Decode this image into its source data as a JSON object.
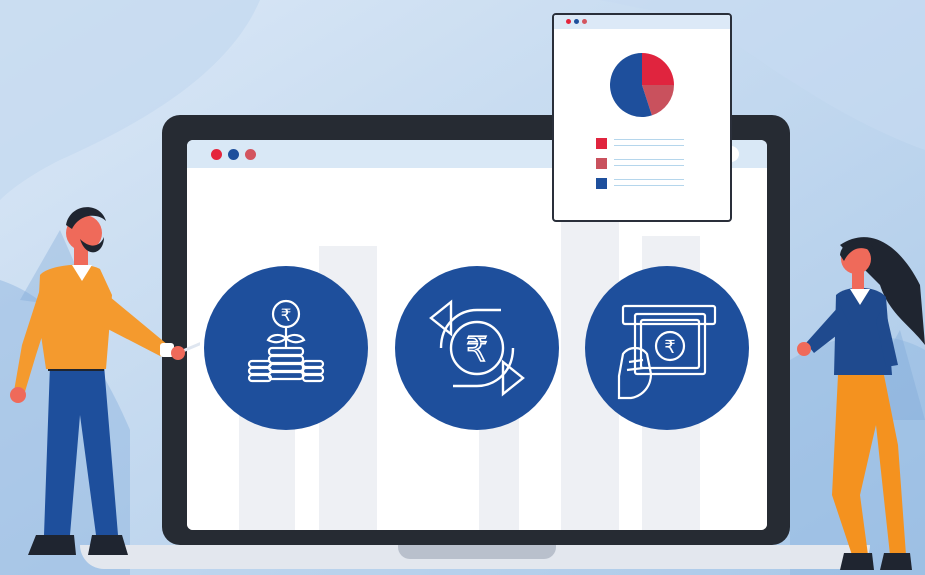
{
  "colors": {
    "background": "#cfe0f3",
    "circle": "#1e4f9c",
    "dot_red": "#e5253c",
    "dot_blue": "#1e4f9c",
    "dot_rose": "#d3555f",
    "pie_red": "#e0243e",
    "pie_rose": "#c9515d",
    "pie_blue": "#1e4f9c",
    "man_shirt": "#f49a2e",
    "man_pants": "#1e4f9c",
    "woman_top": "#1f4a8e",
    "woman_pants": "#f4921f"
  },
  "icons": [
    "rupee-coin-plant-icon",
    "rupee-exchange-cycle-icon",
    "rupee-cash-withdraw-icon",
    "search-icon"
  ],
  "chart_data": {
    "type": "pie",
    "categories": [
      "red",
      "rose",
      "blue"
    ],
    "values": [
      25,
      20,
      55
    ],
    "title": "",
    "legend": "bottom"
  }
}
